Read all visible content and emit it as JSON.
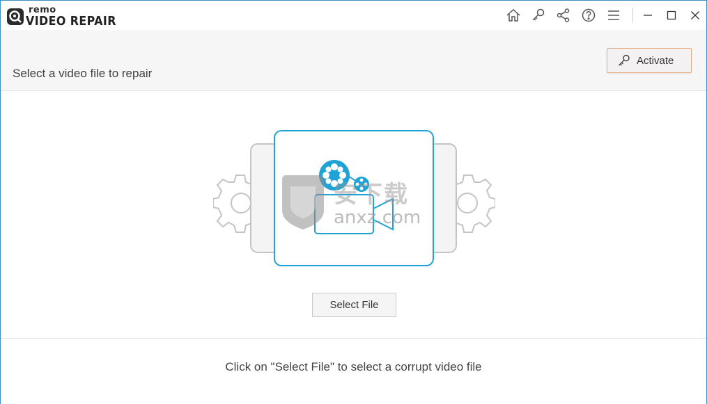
{
  "app": {
    "logo_top": "remo",
    "logo_product": "VIDEO REPAIR"
  },
  "toolbar": {
    "icons": [
      "home-icon",
      "key-icon",
      "share-icon",
      "help-icon",
      "menu-icon"
    ]
  },
  "window_controls": [
    "minimize-icon",
    "maximize-icon",
    "close-icon"
  ],
  "header": {
    "subtitle": "Select a video file to repair",
    "activate_label": "Activate"
  },
  "main": {
    "select_file_label": "Select File"
  },
  "footer": {
    "hint": "Click on \"Select File\" to select a corrupt video file"
  },
  "watermark": {
    "cn": "安下载",
    "en": "anxz.com"
  },
  "colors": {
    "accent_blue": "#1fa2d6",
    "activate_border": "#e8a97a",
    "gear_grey": "#c8c8c8"
  }
}
